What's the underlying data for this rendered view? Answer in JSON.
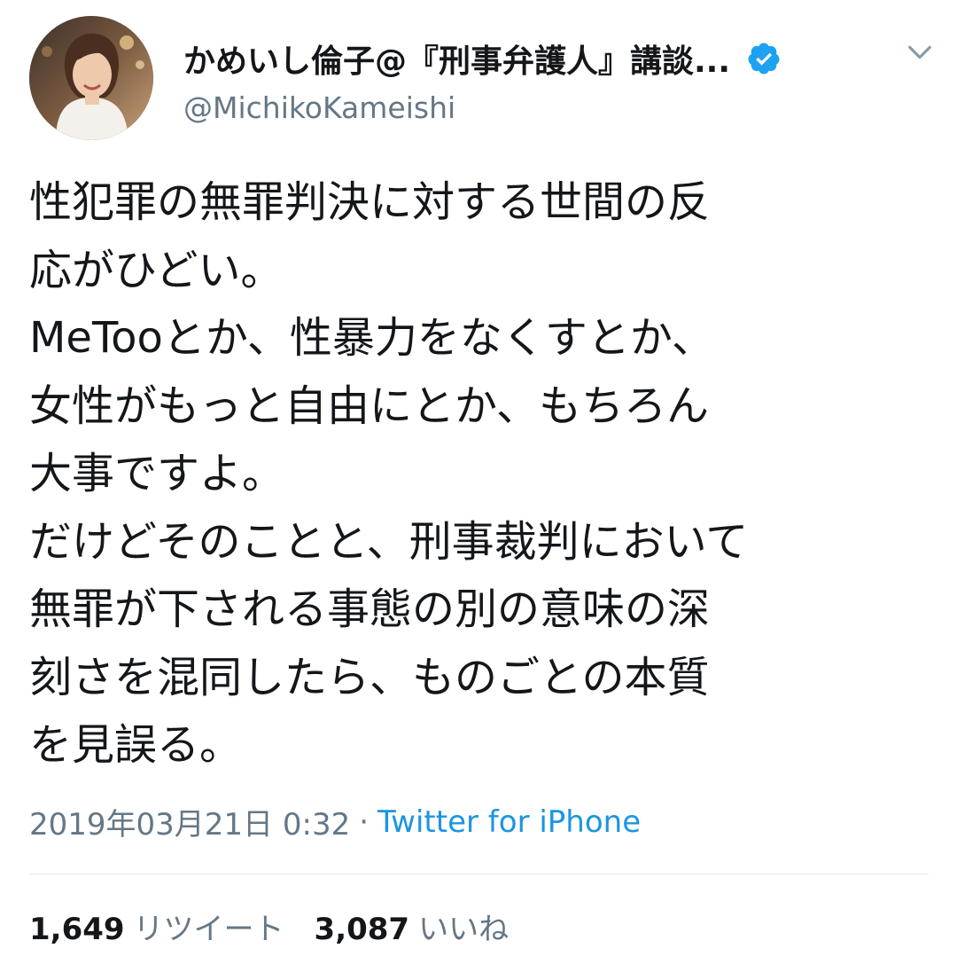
{
  "author": {
    "display_name": "かめいし倫子@『刑事弁護人』講談...",
    "handle": "@MichikoKameishi",
    "verified": true
  },
  "tweet": {
    "lines": [
      "性犯罪の無罪判決に対する世間の反",
      "応がひどい。",
      "MeTooとか、性暴力をなくすとか、",
      "女性がもっと自由にとか、もちろん",
      "大事ですよ。",
      "だけどそのことと、刑事裁判において",
      "無罪が下される事態の別の意味の深",
      "刻さを混同したら、ものごとの本質",
      "を見誤る。"
    ]
  },
  "meta": {
    "timestamp": "2019年03月21日 0:32",
    "separator": "·",
    "source": "Twitter for iPhone"
  },
  "stats": {
    "retweets_count": "1,649",
    "retweets_label": "リツイート",
    "likes_count": "3,087",
    "likes_label": "いいね"
  },
  "icons": {
    "verified": "verified-badge-icon",
    "menu": "chevron-down-icon"
  },
  "colors": {
    "text": "#14171a",
    "secondary": "#657786",
    "link": "#1b95e0",
    "verified": "#1da1f2",
    "divider": "#e1e8ed"
  }
}
